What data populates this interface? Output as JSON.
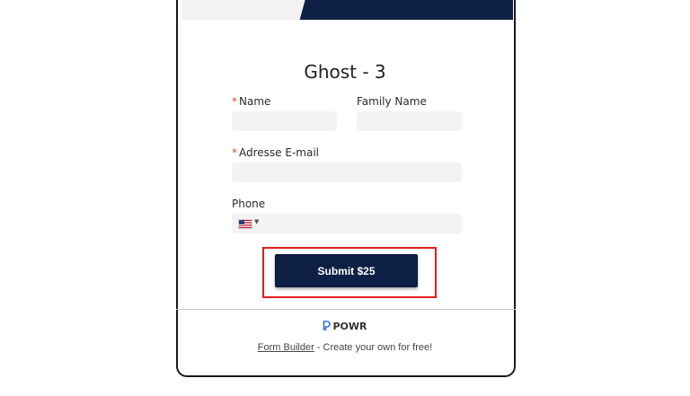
{
  "form": {
    "title": "Ghost - 3",
    "fields": {
      "name": {
        "label": "Name",
        "required_mark": "*",
        "value": ""
      },
      "family_name": {
        "label": "Family Name",
        "value": ""
      },
      "email": {
        "label": "Adresse E-mail",
        "required_mark": "*",
        "value": ""
      },
      "phone": {
        "label": "Phone",
        "value": "",
        "country_flag_icon": "us-flag-icon"
      }
    },
    "submit_label": "Submit $25"
  },
  "footer": {
    "brand": "POWR",
    "link_text": "Form Builder",
    "tagline": " - Create your own for free!"
  },
  "colors": {
    "brand_navy": "#0d1f45",
    "required_red": "#e0463a",
    "highlight_red": "#e01e1e",
    "field_bg": "#f3f3f3",
    "powr_icon_blue": "#2f6fe4"
  }
}
